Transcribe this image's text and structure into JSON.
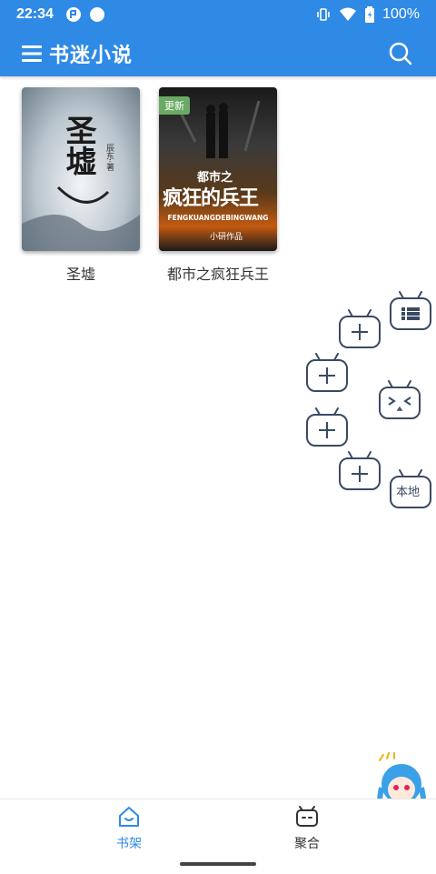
{
  "status_bar": {
    "time": "22:34",
    "battery": "100%"
  },
  "app_bar": {
    "title": "书迷小说"
  },
  "books": [
    {
      "title": "圣墟",
      "cover_text": "圣墟",
      "cover_author": "辰东·著",
      "badge": ""
    },
    {
      "title": "都市之疯狂兵王",
      "cover_text_top": "都市之",
      "cover_text_main": "疯狂的兵王",
      "cover_pinyin": "FENGKUANGDEBINGWANG",
      "cover_author": "小研作品",
      "badge": "更新"
    }
  ],
  "fab_menu": {
    "local_label": "本地",
    "expression": "> <"
  },
  "bottom_nav": [
    {
      "label": "书架",
      "active": true
    },
    {
      "label": "聚合",
      "active": false
    }
  ],
  "colors": {
    "primary": "#2f8ae6",
    "fab_outline": "#3a4a63",
    "update_badge": "#6aaa64"
  }
}
